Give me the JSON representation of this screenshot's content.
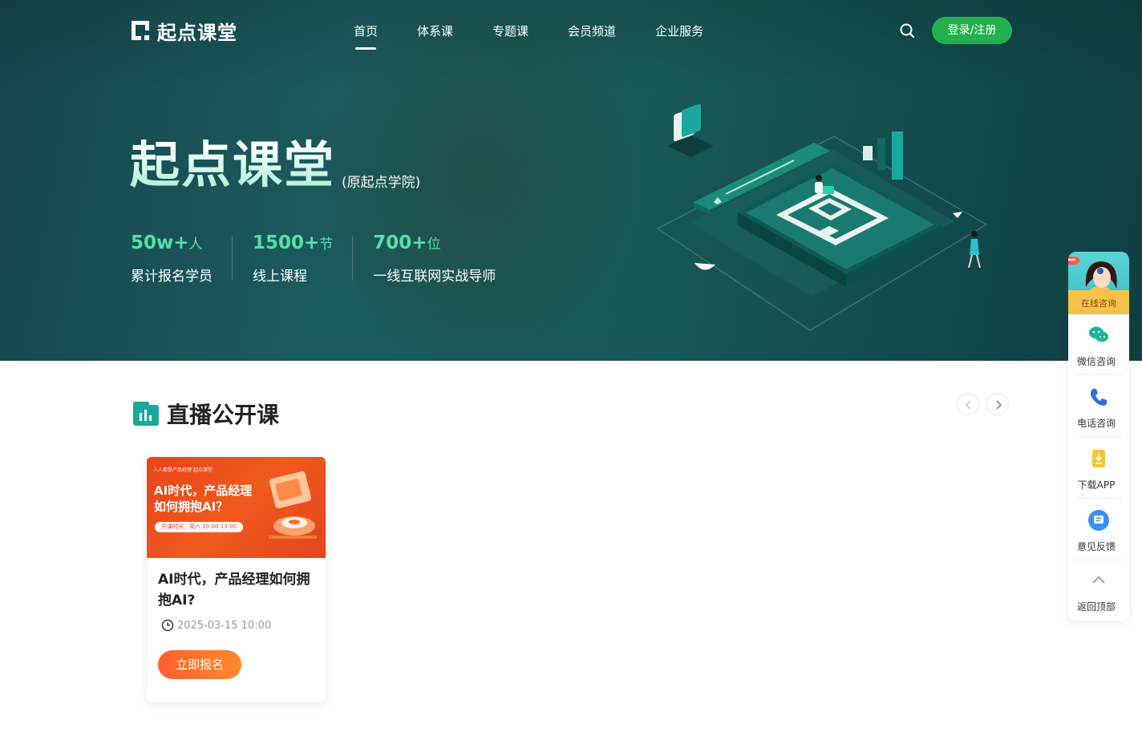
{
  "nav": {
    "logo_text": "起点课堂",
    "links": [
      "首页",
      "体系课",
      "专题课",
      "会员频道",
      "企业服务"
    ],
    "login_label": "登录/注册"
  },
  "hero": {
    "title": "起点课堂",
    "subtitle": "(原起点学院)",
    "stats": [
      {
        "num": "50w+",
        "unit": "人",
        "label": "累计报名学员"
      },
      {
        "num": "1500+",
        "unit": "节",
        "label": "线上课程"
      },
      {
        "num": "700+",
        "unit": "位",
        "label": "一线互联网实战导师"
      }
    ]
  },
  "live": {
    "section_title": "直播公开课",
    "card": {
      "image_brand": "人人都是产品经理  起点课堂",
      "image_headline_1": "AI时代，产品经理",
      "image_headline_2": "如何拥抱AI？",
      "image_time": "开课时间：周六 10:00-13:00",
      "title": "AI时代，产品经理如何拥抱AI?",
      "date": "2025-03-15 10:00",
      "button": "立即报名"
    }
  },
  "sidebar": {
    "top_label": "在线咨询",
    "items": [
      {
        "label": "微信咨询",
        "icon": "wechat-icon"
      },
      {
        "label": "电话咨询",
        "icon": "phone-icon"
      },
      {
        "label": "下载APP",
        "icon": "download-icon"
      },
      {
        "label": "意见反馈",
        "icon": "feedback-icon"
      },
      {
        "label": "返回顶部",
        "icon": "chevron-up-icon"
      }
    ]
  },
  "colors": {
    "brand_green": "#22b14c",
    "stat_green": "#56e0a8",
    "hero_bg": "#1b5a5c",
    "orange": "#ff6a2c",
    "teal_icon": "#1aa89c"
  }
}
